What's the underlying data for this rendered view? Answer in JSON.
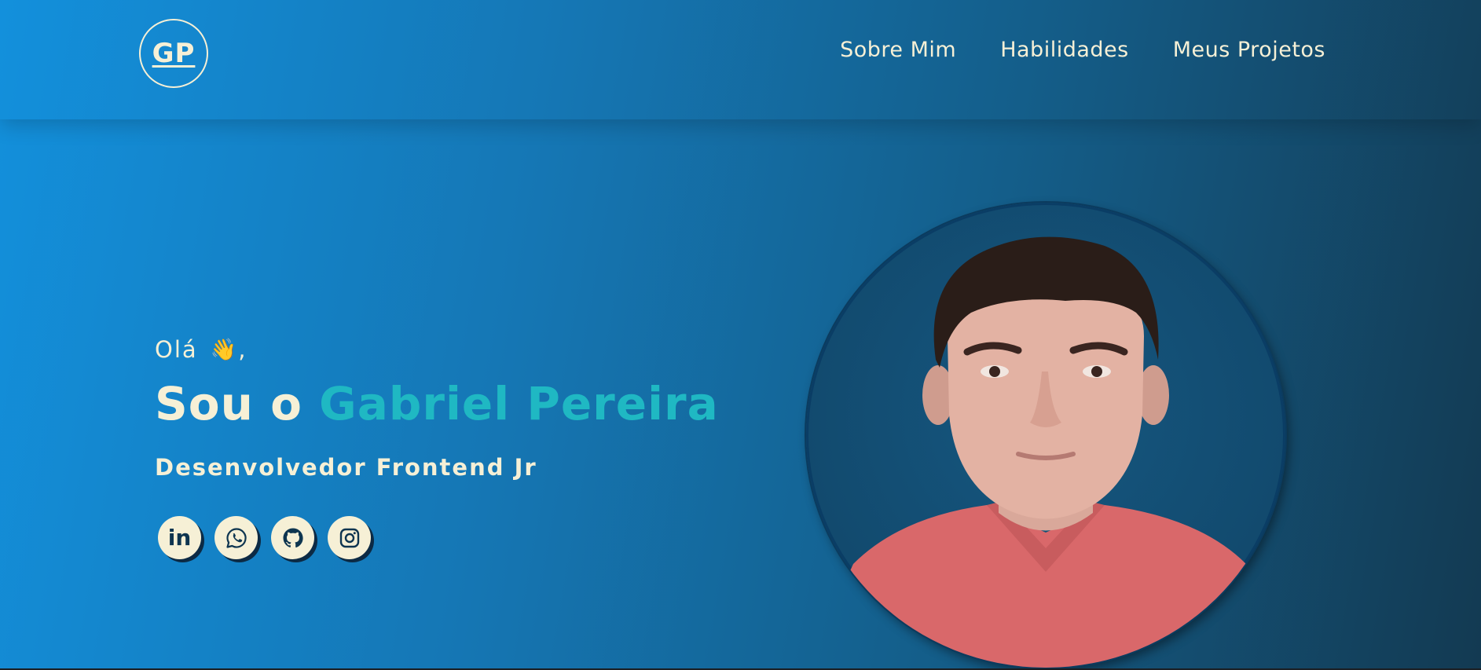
{
  "header": {
    "logo_text": "GP",
    "nav": [
      {
        "label": "Sobre Mim"
      },
      {
        "label": "Habilidades"
      },
      {
        "label": "Meus Projetos"
      }
    ]
  },
  "hero": {
    "greeting": "Olá",
    "greeting_suffix": ",",
    "greeting_emoji": "👋",
    "title_intro": "Sou o ",
    "title_name": "Gabriel Pereira",
    "role": "Desenvolvedor Frontend Jr",
    "socials": [
      {
        "icon": "linkedin-icon",
        "text": "in"
      },
      {
        "icon": "whatsapp-icon"
      },
      {
        "icon": "github-icon"
      },
      {
        "icon": "instagram-icon"
      }
    ],
    "portrait": "profile-photo"
  },
  "colors": {
    "text_cream": "#f6f0d6",
    "accent_teal": "#1fb8c3",
    "gradient_start": "#1390dc",
    "gradient_end": "#133a52"
  }
}
